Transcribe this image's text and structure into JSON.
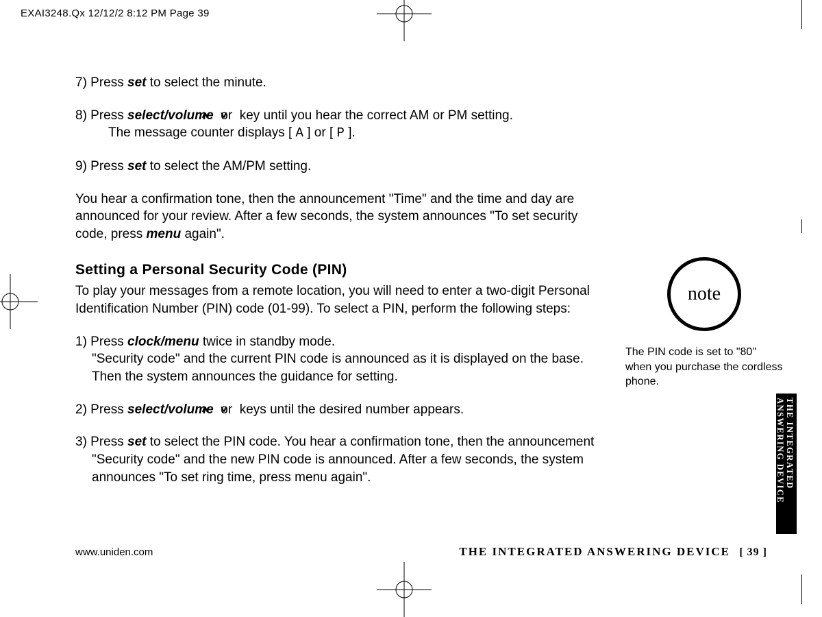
{
  "header": "EXAI3248.Qx  12/12/2 8:12 PM  Page 39",
  "body": {
    "p7a": "7) Press ",
    "p7b": "set",
    "p7c": " to select the minute.",
    "p8a": "8) Press ",
    "p8b": "select/volume",
    "p8c": "  or  ",
    "p8d": " key until you hear the correct AM or PM setting.",
    "p8e": "The message counter displays [ ",
    "p8f": "A",
    "p8g": " ] or [ ",
    "p8h": "P",
    "p8i": " ].",
    "p9a": "9) Press ",
    "p9b": "set",
    "p9c": " to select the AM/PM setting.",
    "conf1": "You hear a confirmation tone, then the announcement \"Time\" and the time and day are announced for your review. After a few seconds, the system announces \"To set security code, press ",
    "conf2": "menu",
    "conf3": " again\".",
    "heading": "Setting a Personal Security Code (PIN)",
    "intro": "To play your messages from a remote location, you will need to enter a two-digit Personal Identification Number (PIN) code (01-99). To select a PIN, perform the following steps:",
    "s1a": "1) Press ",
    "s1b": "clock/menu",
    "s1c": " twice in standby mode.",
    "s1d": "\"Security code\" and the current PIN code is announced as it is displayed on the base. Then the system announces the guidance for setting.",
    "s2a": "2) Press ",
    "s2b": "select/volume",
    "s2c": "  or  ",
    "s2d": " keys until the desired number appears.",
    "s3a": "3) Press ",
    "s3b": "set",
    "s3c": " to select the PIN code. You hear a confirmation tone, then the announcement \"Security code\" and the new PIN code is announced. After a few seconds, the system announces \"To set ring time, press menu again\"."
  },
  "note": {
    "label": "note",
    "text": "The PIN code is set to \"80\" when you purchase the cordless phone."
  },
  "footer": {
    "url": "www.uniden.com",
    "title": "THE INTEGRATED ANSWERING DEVICE",
    "page": "[ 39 ]"
  },
  "sidetab": {
    "line1": "THE INTEGRATED",
    "line2": "ANSWERING DEVICE"
  }
}
